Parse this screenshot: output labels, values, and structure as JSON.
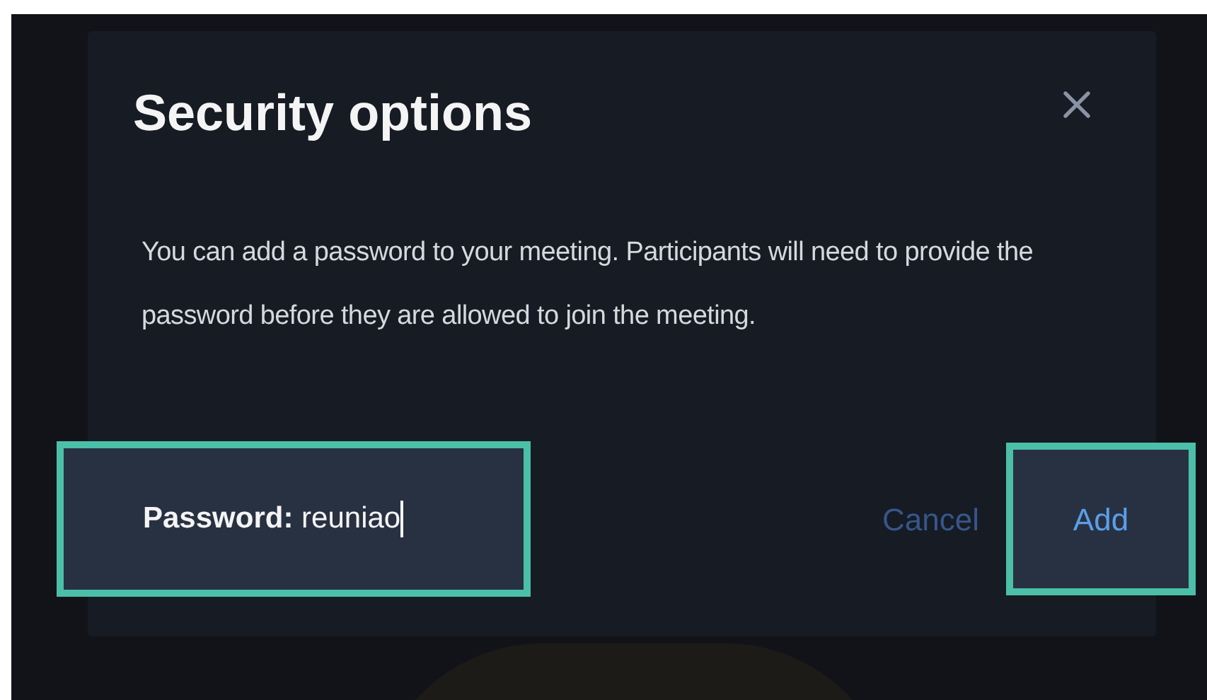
{
  "dialog": {
    "title": "Security options",
    "description": "You can add a password to your meeting. Participants will need to provide the password before they are allowed to join the meeting.",
    "password": {
      "label": "Password:",
      "value": "reuniao",
      "highlighted": true
    },
    "buttons": [
      {
        "label": "Cancel",
        "kind": "secondary",
        "highlighted": false
      },
      {
        "label": "Add",
        "kind": "primary",
        "highlighted": true
      }
    ]
  }
}
